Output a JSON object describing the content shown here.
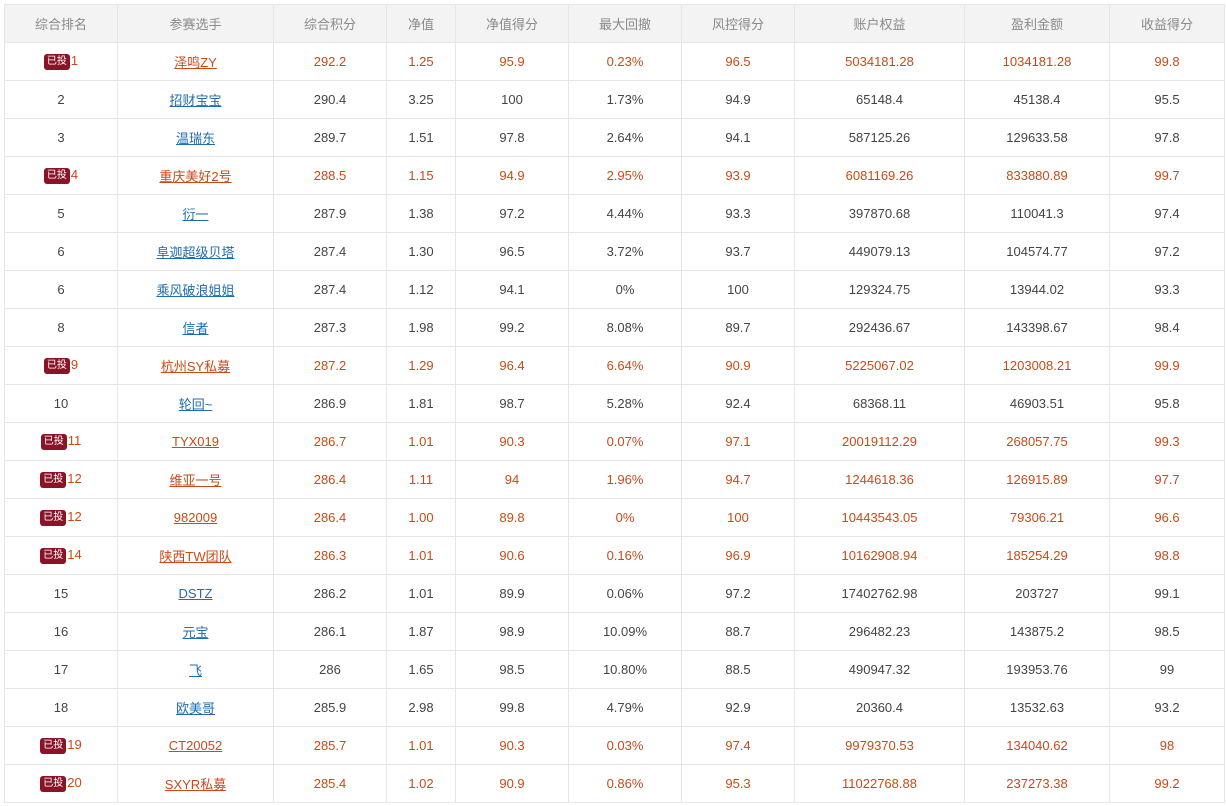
{
  "colors": {
    "highlight": "#c94a17",
    "link": "#1f6cb0",
    "badge_bg": "#8b1328",
    "header_bg": "#f3f3f3"
  },
  "headers": [
    "综合排名",
    "参赛选手",
    "综合积分",
    "净值",
    "净值得分",
    "最大回撤",
    "风控得分",
    "账户权益",
    "盈利金额",
    "收益得分"
  ],
  "rows": [
    {
      "rank": "1",
      "invested": true,
      "name": "泽鸣ZY",
      "score": "292.2",
      "nav": "1.25",
      "nav_score": "95.9",
      "drawdown": "0.23%",
      "risk_score": "96.5",
      "equity": "5034181.28",
      "profit": "1034181.28",
      "return_score": "99.8"
    },
    {
      "rank": "2",
      "invested": false,
      "name": "招财宝宝",
      "score": "290.4",
      "nav": "3.25",
      "nav_score": "100",
      "drawdown": "1.73%",
      "risk_score": "94.9",
      "equity": "65148.4",
      "profit": "45138.4",
      "return_score": "95.5"
    },
    {
      "rank": "3",
      "invested": false,
      "name": "温瑞东",
      "score": "289.7",
      "nav": "1.51",
      "nav_score": "97.8",
      "drawdown": "2.64%",
      "risk_score": "94.1",
      "equity": "587125.26",
      "profit": "129633.58",
      "return_score": "97.8"
    },
    {
      "rank": "4",
      "invested": true,
      "name": "重庆美好2号",
      "score": "288.5",
      "nav": "1.15",
      "nav_score": "94.9",
      "drawdown": "2.95%",
      "risk_score": "93.9",
      "equity": "6081169.26",
      "profit": "833880.89",
      "return_score": "99.7"
    },
    {
      "rank": "5",
      "invested": false,
      "name": "衍一",
      "score": "287.9",
      "nav": "1.38",
      "nav_score": "97.2",
      "drawdown": "4.44%",
      "risk_score": "93.3",
      "equity": "397870.68",
      "profit": "110041.3",
      "return_score": "97.4"
    },
    {
      "rank": "6",
      "invested": false,
      "name": "阜迦超级贝塔",
      "score": "287.4",
      "nav": "1.30",
      "nav_score": "96.5",
      "drawdown": "3.72%",
      "risk_score": "93.7",
      "equity": "449079.13",
      "profit": "104574.77",
      "return_score": "97.2"
    },
    {
      "rank": "6",
      "invested": false,
      "name": "乘风破浪姐姐",
      "score": "287.4",
      "nav": "1.12",
      "nav_score": "94.1",
      "drawdown": "0%",
      "risk_score": "100",
      "equity": "129324.75",
      "profit": "13944.02",
      "return_score": "93.3"
    },
    {
      "rank": "8",
      "invested": false,
      "name": "信者",
      "score": "287.3",
      "nav": "1.98",
      "nav_score": "99.2",
      "drawdown": "8.08%",
      "risk_score": "89.7",
      "equity": "292436.67",
      "profit": "143398.67",
      "return_score": "98.4"
    },
    {
      "rank": "9",
      "invested": true,
      "name": "杭州SY私募",
      "score": "287.2",
      "nav": "1.29",
      "nav_score": "96.4",
      "drawdown": "6.64%",
      "risk_score": "90.9",
      "equity": "5225067.02",
      "profit": "1203008.21",
      "return_score": "99.9"
    },
    {
      "rank": "10",
      "invested": false,
      "name": "轮回~",
      "score": "286.9",
      "nav": "1.81",
      "nav_score": "98.7",
      "drawdown": "5.28%",
      "risk_score": "92.4",
      "equity": "68368.11",
      "profit": "46903.51",
      "return_score": "95.8"
    },
    {
      "rank": "11",
      "invested": true,
      "name": "TYX019",
      "score": "286.7",
      "nav": "1.01",
      "nav_score": "90.3",
      "drawdown": "0.07%",
      "risk_score": "97.1",
      "equity": "20019112.29",
      "profit": "268057.75",
      "return_score": "99.3"
    },
    {
      "rank": "12",
      "invested": true,
      "name": "维亚一号",
      "score": "286.4",
      "nav": "1.11",
      "nav_score": "94",
      "drawdown": "1.96%",
      "risk_score": "94.7",
      "equity": "1244618.36",
      "profit": "126915.89",
      "return_score": "97.7"
    },
    {
      "rank": "12",
      "invested": true,
      "name": "982009",
      "score": "286.4",
      "nav": "1.00",
      "nav_score": "89.8",
      "drawdown": "0%",
      "risk_score": "100",
      "equity": "10443543.05",
      "profit": "79306.21",
      "return_score": "96.6"
    },
    {
      "rank": "14",
      "invested": true,
      "name": "陕西TW团队",
      "score": "286.3",
      "nav": "1.01",
      "nav_score": "90.6",
      "drawdown": "0.16%",
      "risk_score": "96.9",
      "equity": "10162908.94",
      "profit": "185254.29",
      "return_score": "98.8"
    },
    {
      "rank": "15",
      "invested": false,
      "name": "DSTZ",
      "score": "286.2",
      "nav": "1.01",
      "nav_score": "89.9",
      "drawdown": "0.06%",
      "risk_score": "97.2",
      "equity": "17402762.98",
      "profit": "203727",
      "return_score": "99.1"
    },
    {
      "rank": "16",
      "invested": false,
      "name": "元宝",
      "score": "286.1",
      "nav": "1.87",
      "nav_score": "98.9",
      "drawdown": "10.09%",
      "risk_score": "88.7",
      "equity": "296482.23",
      "profit": "143875.2",
      "return_score": "98.5"
    },
    {
      "rank": "17",
      "invested": false,
      "name": "飞",
      "score": "286",
      "nav": "1.65",
      "nav_score": "98.5",
      "drawdown": "10.80%",
      "risk_score": "88.5",
      "equity": "490947.32",
      "profit": "193953.76",
      "return_score": "99"
    },
    {
      "rank": "18",
      "invested": false,
      "name": "欧美哥",
      "score": "285.9",
      "nav": "2.98",
      "nav_score": "99.8",
      "drawdown": "4.79%",
      "risk_score": "92.9",
      "equity": "20360.4",
      "profit": "13532.63",
      "return_score": "93.2"
    },
    {
      "rank": "19",
      "invested": true,
      "name": "CT20052",
      "score": "285.7",
      "nav": "1.01",
      "nav_score": "90.3",
      "drawdown": "0.03%",
      "risk_score": "97.4",
      "equity": "9979370.53",
      "profit": "134040.62",
      "return_score": "98"
    },
    {
      "rank": "20",
      "invested": true,
      "name": "SXYR私募",
      "score": "285.4",
      "nav": "1.02",
      "nav_score": "90.9",
      "drawdown": "0.86%",
      "risk_score": "95.3",
      "equity": "11022768.88",
      "profit": "237273.38",
      "return_score": "99.2"
    }
  ],
  "badge_label": "已投"
}
